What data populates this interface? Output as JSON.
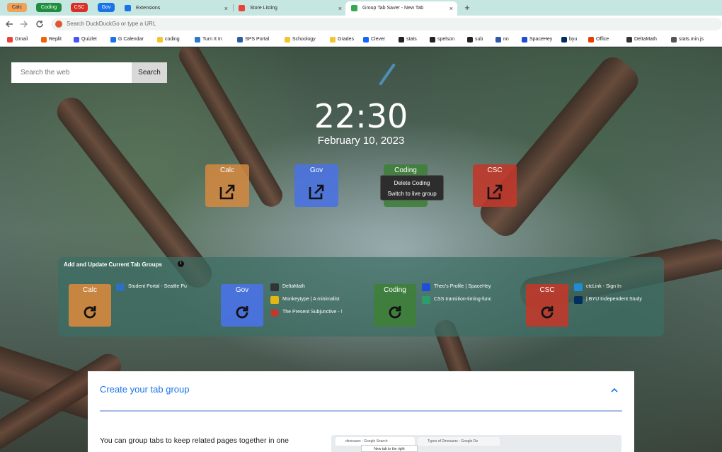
{
  "browser": {
    "tab_groups": [
      {
        "label": "Calc",
        "color": "#f0a25a"
      },
      {
        "label": "Coding",
        "color": "#1e8e3e"
      },
      {
        "label": "CSC",
        "color": "#d93025"
      },
      {
        "label": "Gov",
        "color": "#1a73e8"
      }
    ],
    "tabs": [
      {
        "title": "Extensions",
        "icon": "puzzle-icon",
        "color": "#1a73e8"
      },
      {
        "title": "Store Listing",
        "icon": "store-icon",
        "color": "#ea4335"
      },
      {
        "title": "Group Tab Saver - New Tab",
        "icon": "extension-icon",
        "color": "#34a853",
        "active": true
      }
    ],
    "new_tab": "+",
    "close_glyph": "×",
    "address_placeholder": "Search DuckDuckGo or type a URL",
    "bookmarks": [
      {
        "label": "Gmail",
        "color": "#ea4335"
      },
      {
        "label": "Replit",
        "color": "#f26207"
      },
      {
        "label": "Quizlet",
        "color": "#4255ff"
      },
      {
        "label": "G Calendar",
        "color": "#1a73e8"
      },
      {
        "label": "coding",
        "color": "#f4c430"
      },
      {
        "label": "Turn It In",
        "color": "#2c7ac9"
      },
      {
        "label": "SPS Portal",
        "color": "#2f5aa8"
      },
      {
        "label": "Schoology",
        "color": "#f4c430"
      },
      {
        "label": "Grades",
        "color": "#f4c430"
      },
      {
        "label": "Clever",
        "color": "#1464ff"
      },
      {
        "label": "stats",
        "color": "#222222"
      },
      {
        "label": "spelson",
        "color": "#222222"
      },
      {
        "label": "sub",
        "color": "#222222"
      },
      {
        "label": "nn",
        "color": "#2f5aa8"
      },
      {
        "label": "SpaceHey",
        "color": "#1d4ed8"
      },
      {
        "label": "byu",
        "color": "#002e5d"
      },
      {
        "label": "Office",
        "color": "#eb3c00"
      },
      {
        "label": "DeltaMath",
        "color": "#333333"
      },
      {
        "label": "stats.min.js",
        "color": "#555555"
      }
    ]
  },
  "page": {
    "search_placeholder": "Search the web",
    "search_button": "Search",
    "time": "22:30",
    "date": "February 10, 2023",
    "launch_tiles": [
      {
        "label": "Calc",
        "color": "#d6883f"
      },
      {
        "label": "Gov",
        "color": "#4a72e0"
      },
      {
        "label": "Coding",
        "color": "#3f7f3a"
      },
      {
        "label": "CSC",
        "color": "#c0392b"
      }
    ],
    "context_menu": {
      "items": [
        "Delete Coding",
        "Switch to live group"
      ]
    },
    "panel": {
      "title": "Add and Update Current Tab Groups",
      "info_glyph": "i",
      "groups": [
        {
          "label": "Calc",
          "color": "#d6883f",
          "tabs": [
            {
              "title": "Student Portal - Seattle Pu",
              "icon_color": "#2f6fbf"
            }
          ]
        },
        {
          "label": "Gov",
          "color": "#4a72e0",
          "tabs": [
            {
              "title": "DeltaMath",
              "icon_color": "#333333"
            },
            {
              "title": "Monkeytype | A minimalist",
              "icon_color": "#e2b714"
            },
            {
              "title": "The Present Subjunctive - !",
              "icon_color": "#c0392b"
            }
          ]
        },
        {
          "label": "Coding",
          "color": "#3f7f3a",
          "tabs": [
            {
              "title": "Theo's Profile | SpaceHey",
              "icon_color": "#1d4ed8"
            },
            {
              "title": "CSS transition-timing-func",
              "icon_color": "#2e9d6a"
            }
          ]
        },
        {
          "label": "CSC",
          "color": "#c0392b",
          "tabs": [
            {
              "title": "ctcLink - Sign In",
              "icon_color": "#1f8dd6"
            },
            {
              "title": "| BYU Independent Study",
              "icon_color": "#002e5d"
            }
          ]
        }
      ]
    },
    "card": {
      "title": "Create your tab group",
      "body": "You can group tabs to keep related pages together in one",
      "mini_tabs": [
        "dinosaurs - Google Search",
        "Types of Dinosaurs - Google Do"
      ],
      "mini_tooltip": "New tab to the right"
    }
  }
}
